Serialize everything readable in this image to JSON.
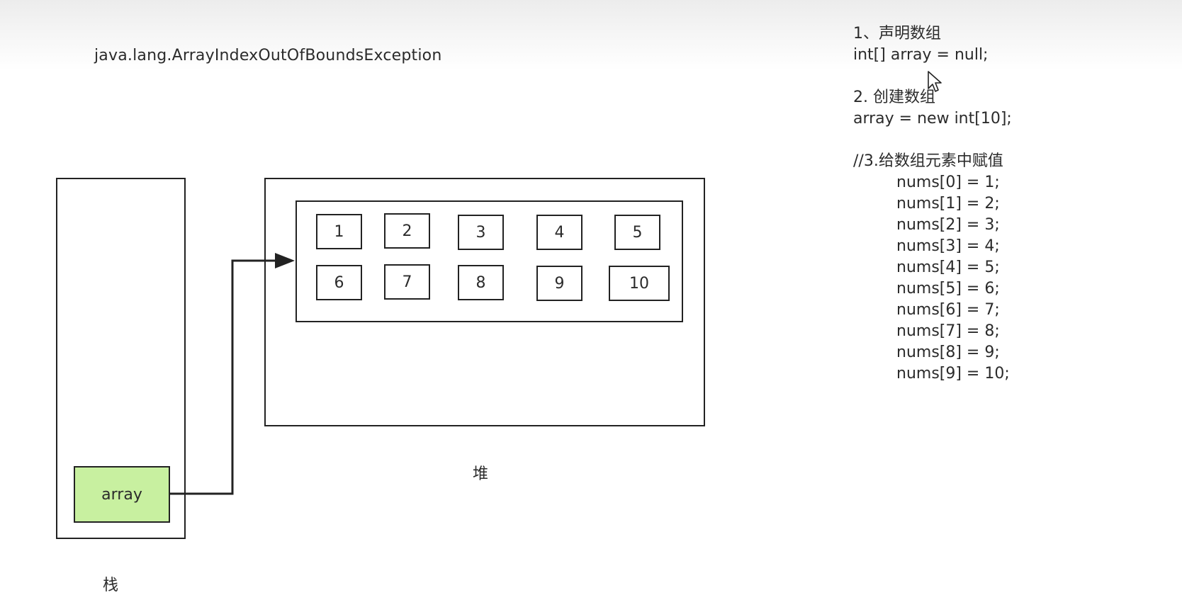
{
  "exception_text": "java.lang.ArrayIndexOutOfBoundsException",
  "stack": {
    "label": "栈",
    "variable": "array"
  },
  "heap": {
    "label": "堆",
    "elements": [
      "1",
      "2",
      "3",
      "4",
      "5",
      "6",
      "7",
      "8",
      "9",
      "10"
    ]
  },
  "code": {
    "step1_title": "1、声明数组",
    "step1_code": "int[] array = null;",
    "step2_title": "2. 创建数组",
    "step2_code": "array = new int[10];",
    "step3_title": "//3.给数组元素中赋值",
    "assignments": [
      "nums[0] = 1;",
      "nums[1] = 2;",
      "nums[2] = 3;",
      "nums[3] = 4;",
      "nums[4] = 5;",
      "nums[5] = 6;",
      "nums[6] = 7;",
      "nums[7] = 8;",
      "nums[8] = 9;",
      "nums[9] = 10;"
    ]
  }
}
